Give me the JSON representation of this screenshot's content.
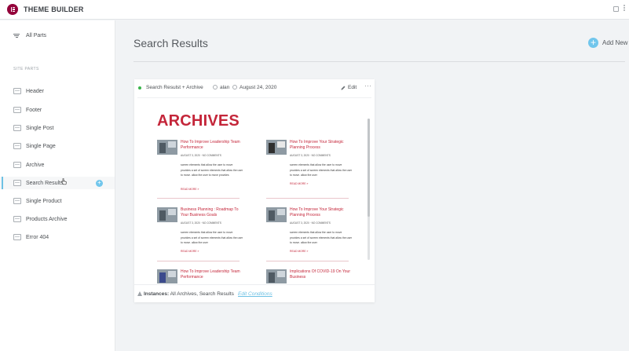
{
  "app": {
    "title": "THEME BUILDER"
  },
  "sidebar": {
    "all_parts": "All Parts",
    "section_label": "SITE PARTS",
    "items": [
      {
        "label": "Header"
      },
      {
        "label": "Footer"
      },
      {
        "label": "Single Post"
      },
      {
        "label": "Single Page"
      },
      {
        "label": "Archive"
      },
      {
        "label": "Search Results",
        "active": true
      },
      {
        "label": "Single Product"
      },
      {
        "label": "Products Archive"
      },
      {
        "label": "Error 404"
      }
    ]
  },
  "main": {
    "title": "Search Results",
    "add_new": "Add New"
  },
  "card": {
    "name": "Search Resulst + Archive",
    "author": "alan",
    "date": "August 24, 2020",
    "edit": "Edit",
    "status_color": "#39b54a",
    "preview": {
      "heading": "ARCHIVES",
      "posts": [
        {
          "title": "How To Improve Leadership Team Performance",
          "meta": "AUGUST 3, 2020 · NO COMMENTS",
          "excerpt": "screen elements that allow the user to move provides a set of screen elements that allow the user to move. allow the user to move provides",
          "more": "READ MORE »"
        },
        {
          "title": "How To Improve Your Strategic Planning Process",
          "meta": "AUGUST 3, 2020 · NO COMMENTS",
          "excerpt": "screen elements that allow the user to move provides a set of screen elements that allow the user to move. allow the user",
          "more": "READ MORE »"
        },
        {
          "title": "Business Planning : Roadmap To Your Business Goals",
          "meta": "AUGUST 3, 2020 · NO COMMENTS",
          "excerpt": "screen elements that allow the user to move provides a set of screen elements that allow the user to move. allow the user",
          "more": "READ MORE »"
        },
        {
          "title": "How To Improve Your Strategic Planning Process",
          "meta": "AUGUST 3, 2020 · NO COMMENTS",
          "excerpt": "screen elements that allow the user to move provides a set of screen elements that allow the user to move. allow the user",
          "more": "READ MORE »"
        },
        {
          "title": "How To Improve Leadership Team Performance",
          "meta": "",
          "excerpt": "",
          "more": ""
        },
        {
          "title": "Implications Of COVID-19 On Your Business",
          "meta": "",
          "excerpt": "",
          "more": ""
        }
      ]
    },
    "footer": {
      "instances_label": "Instances:",
      "instances_value": "All Archives, Search Results",
      "edit_conditions": "Edit Conditions"
    }
  },
  "colors": {
    "accent": "#6ec1e4",
    "brand": "#93003a",
    "archive_red": "#c4263a"
  }
}
